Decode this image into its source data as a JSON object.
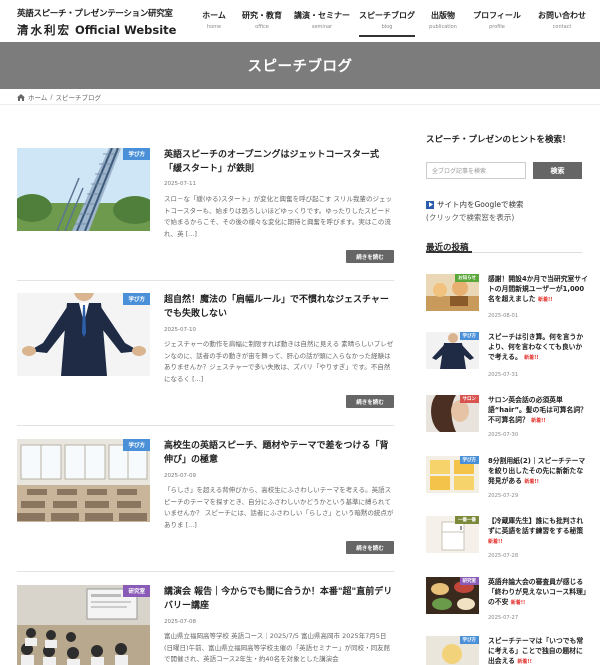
{
  "site": {
    "title_sub": "英語スピーチ・プレゼンテーション研究室",
    "title_name": "清水利宏",
    "title_suffix": "Official Website"
  },
  "nav": [
    {
      "label": "ホーム",
      "sub": "home"
    },
    {
      "label": "研究・教育",
      "sub": "office"
    },
    {
      "label": "講演・セミナー",
      "sub": "seminar"
    },
    {
      "label": "スピーチブログ",
      "sub": "blog"
    },
    {
      "label": "出版物",
      "sub": "publication"
    },
    {
      "label": "プロフィール",
      "sub": "profile"
    },
    {
      "label": "お問い合わせ",
      "sub": "contact"
    }
  ],
  "banner_title": "スピーチブログ",
  "breadcrumb": {
    "home": "ホーム",
    "sep": "/",
    "current": "スピーチブログ"
  },
  "posts": [
    {
      "category": "学び方",
      "title": "英語スピーチのオープニングはジェットコースター式「緩スタート」が鉄則",
      "date": "2025-07-11",
      "excerpt": "スロ－な「緩(ゆる)スタート」が変化と興奮を呼び起こす スリル我輩のジェットコースターも、始まりは恐ろしいほどゆっくりです。ゆったりしたスピードで始まるからこそ、その後の様々な変化に期待と興奮を呼びます。実はこの流れ、英 [...]",
      "more": "続きを読む"
    },
    {
      "category": "学び方",
      "title": "超自然！魔法の「肩幅ルール」で不慣れなジェスチャーでも失敗しない",
      "date": "2025-07-10",
      "excerpt": "ジェスチャーの動作を肩幅に制限すれば動きは自然に見える 素晴らしいプレゼンなのに、話者の手の動きが宙を舞って、肝心の話が頭に入らなかった経験はありませんか？ジェスチャーで多い失敗は、ズバリ「やりすぎ」です。不自然になるく [...]",
      "more": "続きを読む"
    },
    {
      "category": "学び方",
      "title": "高校生の英語スピーチ、題材やテーマで差をつける「背伸び」の極意",
      "date": "2025-07-09",
      "excerpt": "「らしさ」を超える背伸びから、高校生にふさわしいテーマを考える。英語スピーチのテーマを探すとき、自分にふさわしいかどうかという基準に縛られていませんか？ スピーチには、話者にふさわしい「らしさ」という暗黙の統点がありま [...]",
      "more": "続きを読む"
    },
    {
      "category": "研究室",
      "title": "講演会 報告｜今からでも間に合うか！本番\"超\"直前デリバリー講座",
      "date": "2025-07-08",
      "excerpt": "富山県立福岡高等学校 英語コース｜2025/7/5 富山県高岡市 2025年7月5日(日曜日)午前、富山県立福岡高等学校主催の「英語セミナー」が同校・同友館で開催され、英語コース2年生・約40名を対象とした講演会",
      "more": "続きを読む"
    }
  ],
  "sidebar": {
    "search_title": "スピーチ・プレゼンのヒントを検索！",
    "search_placeholder": "全ブログ記事を検索",
    "search_button": "検索",
    "google_link": "サイト内をGoogleで検索",
    "google_note": "(クリックで検索窓を表示)",
    "recent_title": "最近の投稿",
    "new_label": "新着!!",
    "recent": [
      {
        "category": "お知らせ",
        "title": "感謝！開設4か月で当研究室サイトの月間新規ユーザーが1,000名を超えました",
        "date": "2025-08-01"
      },
      {
        "category": "学び方",
        "title": "スピーチは引き算。何を言うかより、何を言わなくても良いかで考える。",
        "date": "2025-07-31"
      },
      {
        "category": "サロン",
        "title": "サロン英会話の必須英単語“hair”。髪の毛は可算名詞？不可算名詞？",
        "date": "2025-07-30"
      },
      {
        "category": "学び方",
        "title": "8分割用紙(2)｜スピーチテーマを絞り出したその先に新新たな発見がある",
        "date": "2025-07-29"
      },
      {
        "category": "一番一番",
        "title": "【冷蔵庫先生】誰にも批判されずに英語を話す練習をする秘策",
        "date": "2025-07-28"
      },
      {
        "category": "研究室",
        "title": "英語弁論大会の審査員が感じる「終わりが見えないコース料理」の不安",
        "date": "2025-07-27"
      },
      {
        "category": "学び方",
        "title": "スピーチテーマは「いつでも常に考える」ことで独自の題材に出会える",
        "date": ""
      }
    ]
  },
  "colors": {
    "banner": "#7c7c7c",
    "cat_learn": "#4a90d9",
    "cat_news": "#5aa73a",
    "cat_salon": "#d9534f",
    "cat_lab": "#8a5cb8",
    "cat_ichiban": "#7a8a3a",
    "button": "#666666"
  }
}
